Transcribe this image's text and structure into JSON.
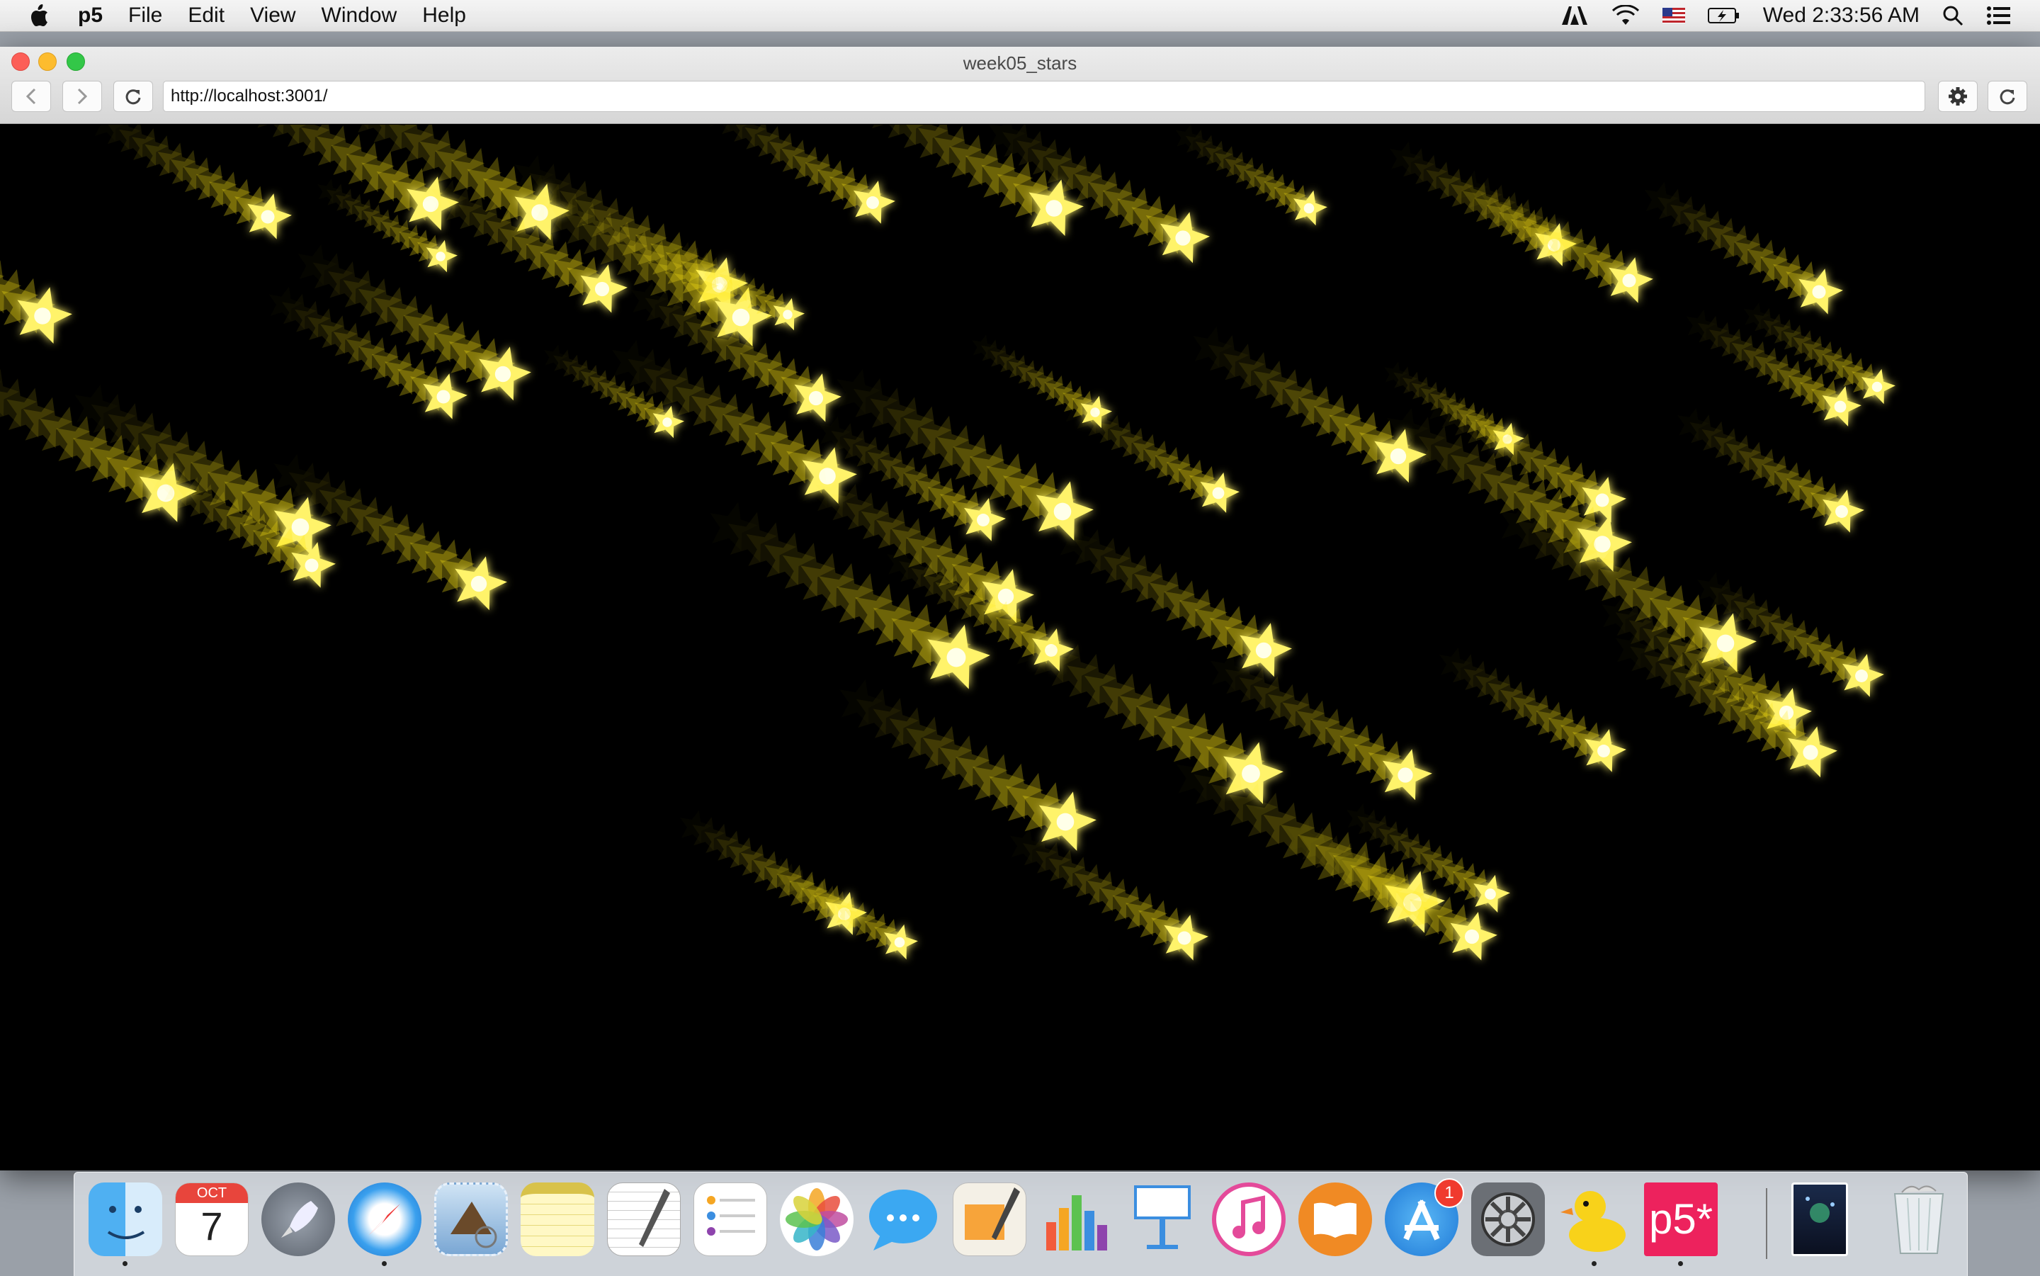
{
  "menubar": {
    "app_name": "p5",
    "menus": [
      "File",
      "Edit",
      "View",
      "Window",
      "Help"
    ],
    "clock": "Wed 2:33:56 AM",
    "status_icons": [
      "adobe-icon",
      "wifi-icon",
      "us-flag-icon",
      "battery-icon",
      "spotlight-icon",
      "notification-center-icon"
    ]
  },
  "window": {
    "title": "week05_stars",
    "url": "http://localhost:3001/",
    "accent_color": "#ffe815"
  },
  "dock": {
    "apps": [
      {
        "name": "Finder",
        "running": true
      },
      {
        "name": "Calendar",
        "month": "OCT",
        "day": "7"
      },
      {
        "name": "Launchpad"
      },
      {
        "name": "Safari",
        "running": true
      },
      {
        "name": "Mail"
      },
      {
        "name": "Notes"
      },
      {
        "name": "TextEdit"
      },
      {
        "name": "Reminders"
      },
      {
        "name": "Photos"
      },
      {
        "name": "Messages"
      },
      {
        "name": "Pages"
      },
      {
        "name": "Numbers"
      },
      {
        "name": "Keynote"
      },
      {
        "name": "iTunes"
      },
      {
        "name": "iBooks"
      },
      {
        "name": "App Store",
        "badge": "1"
      },
      {
        "name": "System Preferences"
      },
      {
        "name": "Cyberduck",
        "running": true
      },
      {
        "name": "p5",
        "label": "p5*",
        "running": true
      }
    ],
    "right_items": [
      "Downloads",
      "Trash"
    ]
  }
}
